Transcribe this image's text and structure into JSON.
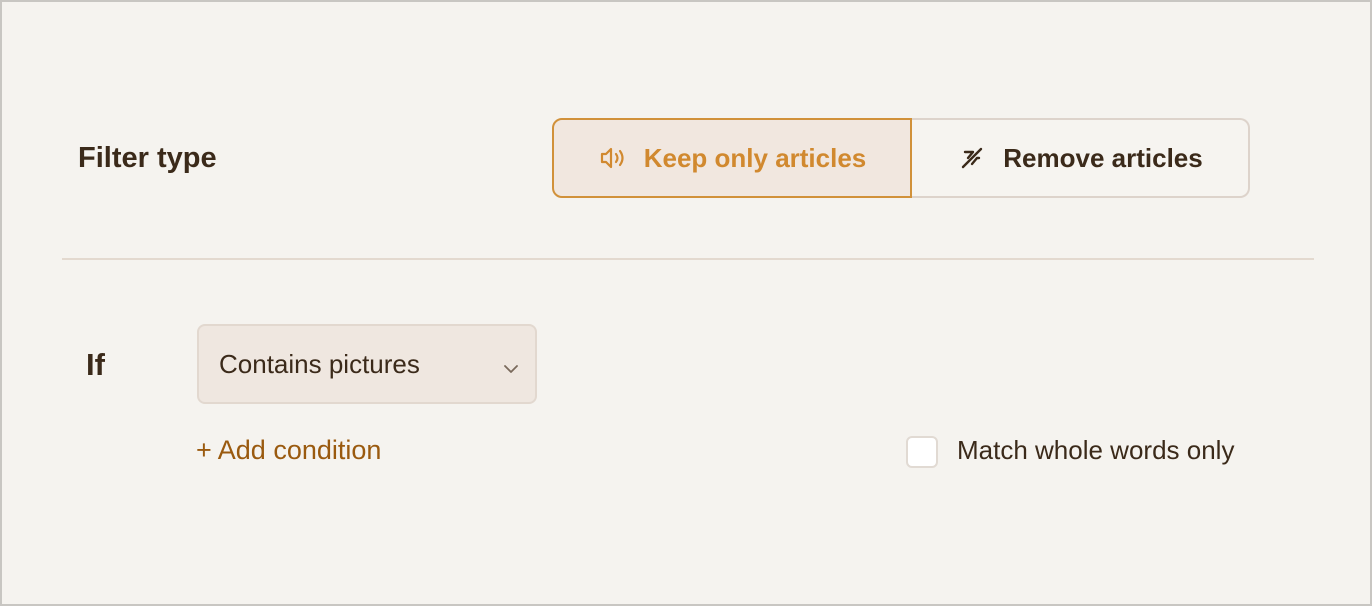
{
  "filter": {
    "label": "Filter type",
    "options": [
      {
        "label": "Keep only articles",
        "icon": "speaker-icon",
        "selected": true
      },
      {
        "label": "Remove articles",
        "icon": "slash-icon",
        "selected": false
      }
    ]
  },
  "condition": {
    "if_label": "If",
    "select": {
      "value": "Contains pictures",
      "icon": "chevron-down-icon"
    },
    "add_condition_label": "+ Add condition",
    "match_whole_words": {
      "label": "Match whole words only",
      "checked": false
    }
  },
  "colors": {
    "accent": "#d1892f",
    "link": "#9a5a0f",
    "text": "#3b2a1a",
    "background": "#f5f3ef"
  }
}
